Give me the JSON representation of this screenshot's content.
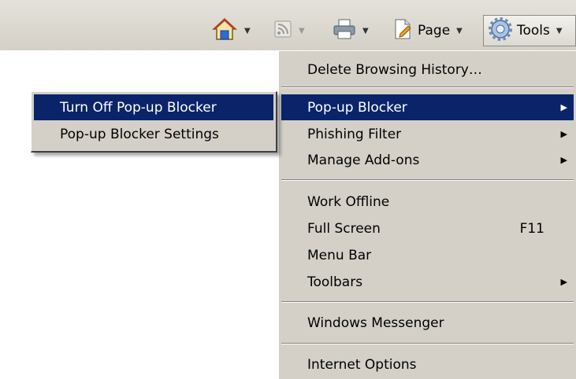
{
  "toolbar": {
    "home_icon": "home-icon",
    "feeds_icon": "feeds-icon",
    "print_icon": "print-icon",
    "page_label": "Page",
    "tools_label": "Tools"
  },
  "tools_menu": {
    "items": [
      {
        "label": "Delete Browsing History…"
      },
      {
        "label": "Pop-up Blocker",
        "selected": true,
        "submenu": true
      },
      {
        "label": "Phishing Filter",
        "submenu": true
      },
      {
        "label": "Manage Add-ons",
        "submenu": true
      },
      {
        "label": "Work Offline"
      },
      {
        "label": "Full Screen",
        "shortcut": "F11"
      },
      {
        "label": "Menu Bar"
      },
      {
        "label": "Toolbars",
        "submenu": true
      },
      {
        "label": "Windows Messenger"
      },
      {
        "label": "Internet Options"
      }
    ]
  },
  "popup_submenu": {
    "items": [
      {
        "label": "Turn Off Pop-up Blocker",
        "selected": true
      },
      {
        "label": "Pop-up Blocker Settings"
      }
    ]
  },
  "colors": {
    "menu_bg": "#d4d0c8",
    "selection": "#0a246a"
  }
}
